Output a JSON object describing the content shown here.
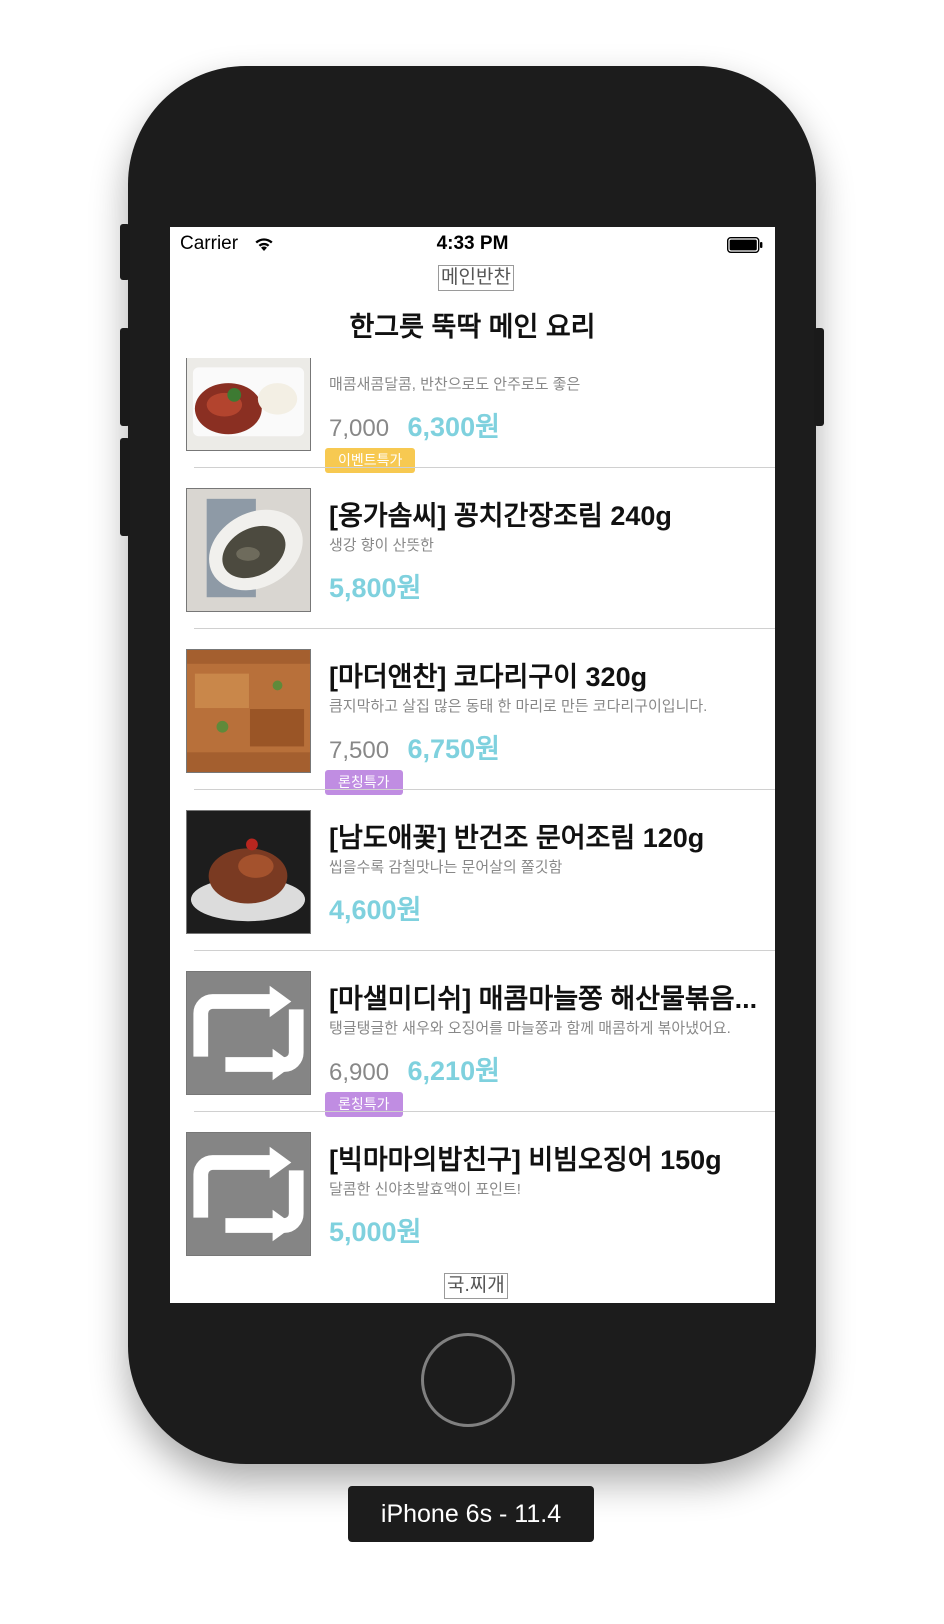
{
  "simulator": {
    "device_label": "iPhone 6s - 11.4"
  },
  "status_bar": {
    "carrier": "Carrier",
    "time": "4:33 PM",
    "icons": [
      "wifi-icon",
      "battery-icon"
    ]
  },
  "section_header": "메인반찬",
  "main_title": "한그릇 뚝딱 메인 요리",
  "items": [
    {
      "title": "",
      "description": "매콤새콤달콤, 반찬으로도 안주로도 좋은",
      "original_price": "7,000",
      "sale_price": "6,300원",
      "badge": "이벤트특가",
      "badge_color": "#f7c951",
      "image": "food-photo"
    },
    {
      "title": "[옹가솜씨] 꽁치간장조림 240g",
      "description": "생강 향이 산뜻한",
      "original_price": "",
      "sale_price": "5,800원",
      "badge": "",
      "badge_color": "",
      "image": "food-photo"
    },
    {
      "title": "[마더앤찬] 코다리구이 320g",
      "description": "큼지막하고 살집 많은 동태 한 마리로 만든 코다리구이입니다.",
      "original_price": "7,500",
      "sale_price": "6,750원",
      "badge": "론칭특가",
      "badge_color": "#c08de2",
      "image": "food-photo"
    },
    {
      "title": "[남도애꽃] 반건조 문어조림 120g",
      "description": "씹을수록 감칠맛나는 문어살의 쫄깃함",
      "original_price": "",
      "sale_price": "4,600원",
      "badge": "",
      "badge_color": "",
      "image": "food-photo"
    },
    {
      "title": "[마샐미디쉬] 매콤마늘쫑 해산물볶음...",
      "description": "탱글탱글한 새우와 오징어를 마늘쫑과 함께 매콤하게 볶아냈어요.",
      "original_price": "6,900",
      "sale_price": "6,210원",
      "badge": "론칭특가",
      "badge_color": "#c08de2",
      "image": "reload-placeholder-icon"
    },
    {
      "title": "[빅마마의밥친구] 비빔오징어 150g",
      "description": "달콤한 신야초발효액이 포인트!",
      "original_price": "",
      "sale_price": "5,000원",
      "badge": "",
      "badge_color": "",
      "image": "reload-placeholder-icon"
    }
  ],
  "next_section_header": "국.찌개",
  "colors": {
    "sale_price": "#7fd1de",
    "event_badge": "#f7c951",
    "launch_badge": "#c08de2",
    "phone_body": "#1c1c1c"
  }
}
